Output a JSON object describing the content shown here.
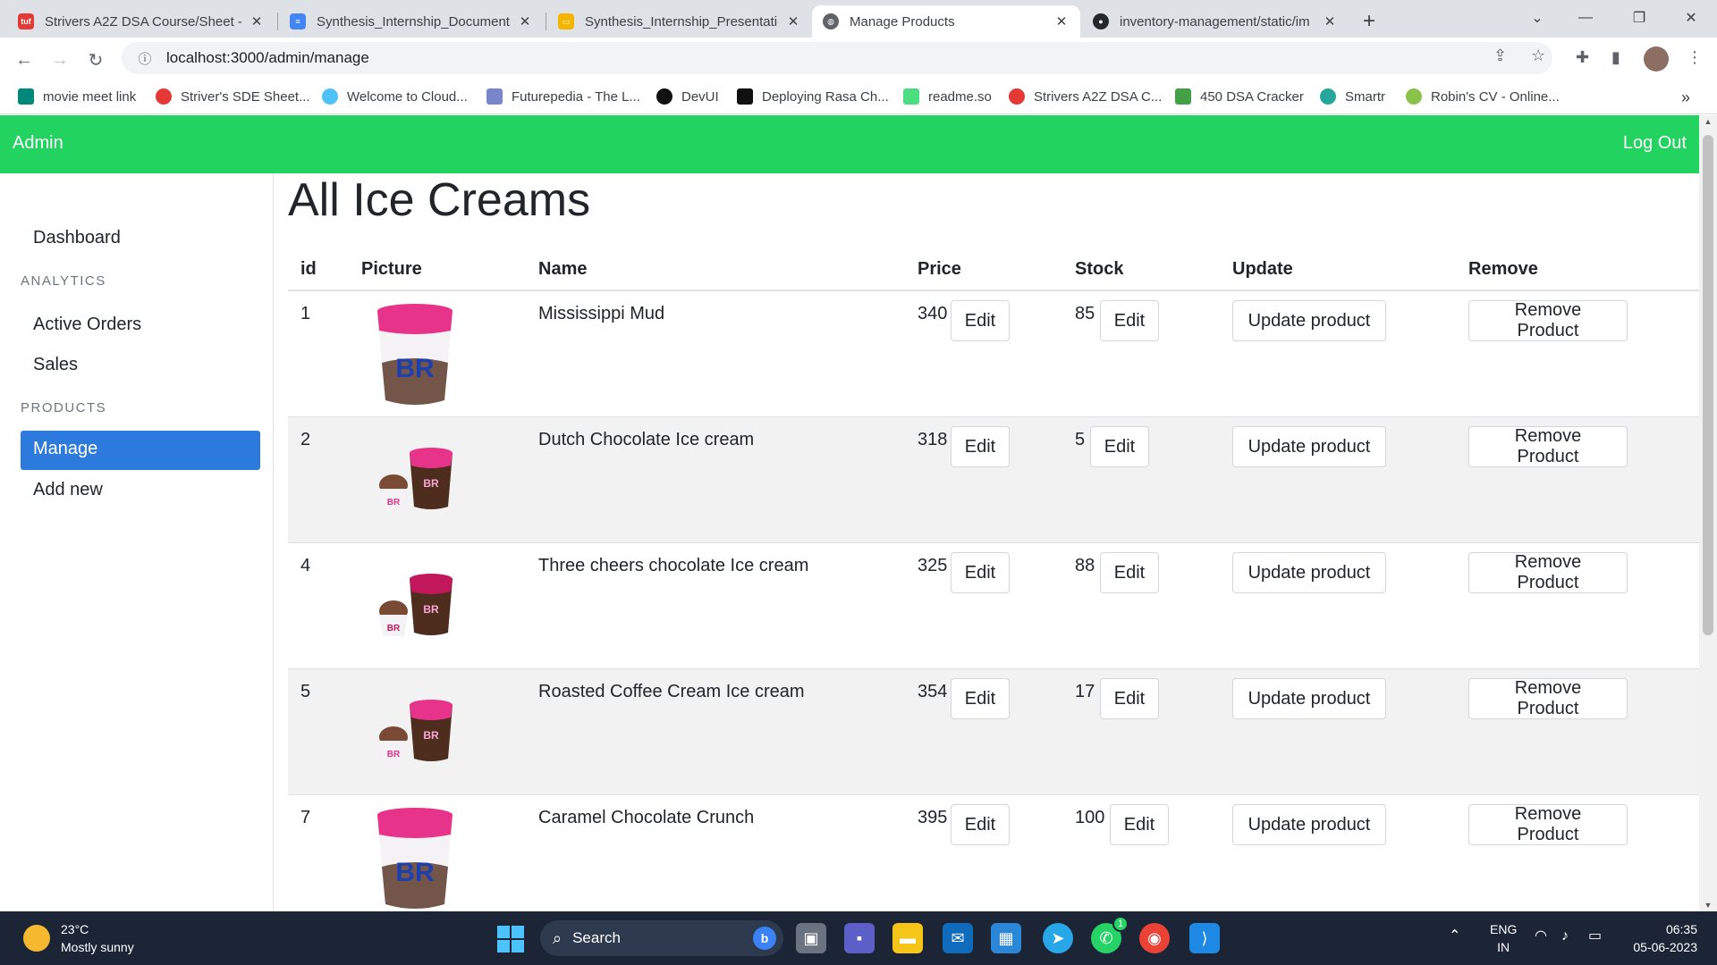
{
  "browser": {
    "tabs": [
      {
        "title": "Strivers A2Z DSA Course/Sheet -",
        "icon": "tuf-icon",
        "color": "#e53935"
      },
      {
        "title": "Synthesis_Internship_Documenta",
        "icon": "google-docs-icon",
        "color": "#4285f4"
      },
      {
        "title": "Synthesis_Internship_Presentatio",
        "icon": "google-slides-icon",
        "color": "#f4b400"
      },
      {
        "title": "Manage Products",
        "icon": "globe-icon",
        "color": "#5f6368"
      },
      {
        "title": "inventory-management/static/im",
        "icon": "github-icon",
        "color": "#24292e"
      }
    ],
    "url": "localhost:3000/admin/manage",
    "bookmarks": [
      {
        "label": "movie meet link",
        "icon": "google-meet-icon",
        "color": "#00897b"
      },
      {
        "label": "Striver's SDE Sheet...",
        "icon": "tuf-icon",
        "color": "#e53935"
      },
      {
        "label": "Welcome to Cloud...",
        "icon": "cloud-icon",
        "color": "#4fc3f7"
      },
      {
        "label": "Futurepedia - The L...",
        "icon": "futurepedia-icon",
        "color": "#7986cb"
      },
      {
        "label": "DevUI",
        "icon": "devui-icon",
        "color": "#111111"
      },
      {
        "label": "Deploying Rasa Ch...",
        "icon": "medium-icon",
        "color": "#111111"
      },
      {
        "label": "readme.so",
        "icon": "readme-icon",
        "color": "#4ade80"
      },
      {
        "label": "Strivers A2Z DSA C...",
        "icon": "tuf-icon",
        "color": "#e53935"
      },
      {
        "label": "450 DSA Cracker",
        "icon": "dsa-cracker-icon",
        "color": "#43a047"
      },
      {
        "label": "Smartr",
        "icon": "smartr-icon",
        "color": "#26a69a"
      },
      {
        "label": "Robin's CV - Online...",
        "icon": "cv-icon",
        "color": "#8bc34a"
      }
    ]
  },
  "app": {
    "brand": "Admin",
    "logout": "Log Out",
    "accent": "#22d35f",
    "active_color": "#2d7adf"
  },
  "sidebar": {
    "dashboard": "Dashboard",
    "analytics_heading": "ANALYTICS",
    "active_orders": "Active Orders",
    "sales": "Sales",
    "products_heading": "PRODUCTS",
    "manage": "Manage",
    "add_new": "Add new"
  },
  "page": {
    "title": "All Ice Creams",
    "columns": {
      "id": "id",
      "picture": "Picture",
      "name": "Name",
      "price": "Price",
      "stock": "Stock",
      "update": "Update",
      "remove": "Remove"
    },
    "edit_label": "Edit",
    "update_label": "Update product",
    "remove_label": "Remove Product",
    "products": [
      {
        "id": "1",
        "name": "Mississippi Mud",
        "price": "340",
        "stock": "85",
        "picture": "single-tub",
        "tub_color": "#e8338a"
      },
      {
        "id": "2",
        "name": "Dutch Chocolate Ice cream",
        "price": "318",
        "stock": "5",
        "picture": "tub-and-cup",
        "tub_color": "#e8338a"
      },
      {
        "id": "4",
        "name": "Three cheers chocolate Ice cream",
        "price": "325",
        "stock": "88",
        "picture": "tub-and-cup",
        "tub_color": "#c2185b"
      },
      {
        "id": "5",
        "name": "Roasted Coffee Cream Ice cream",
        "price": "354",
        "stock": "17",
        "picture": "tub-and-cup",
        "tub_color": "#e8338a"
      },
      {
        "id": "7",
        "name": "Caramel Chocolate Crunch",
        "price": "395",
        "stock": "100",
        "picture": "single-tub",
        "tub_color": "#e8338a"
      }
    ]
  },
  "taskbar": {
    "temp": "23°C",
    "weather": "Mostly sunny",
    "search": "Search",
    "lang1": "ENG",
    "lang2": "IN",
    "time": "06:35",
    "date": "05-06-2023",
    "whatsapp_badge": "1"
  }
}
